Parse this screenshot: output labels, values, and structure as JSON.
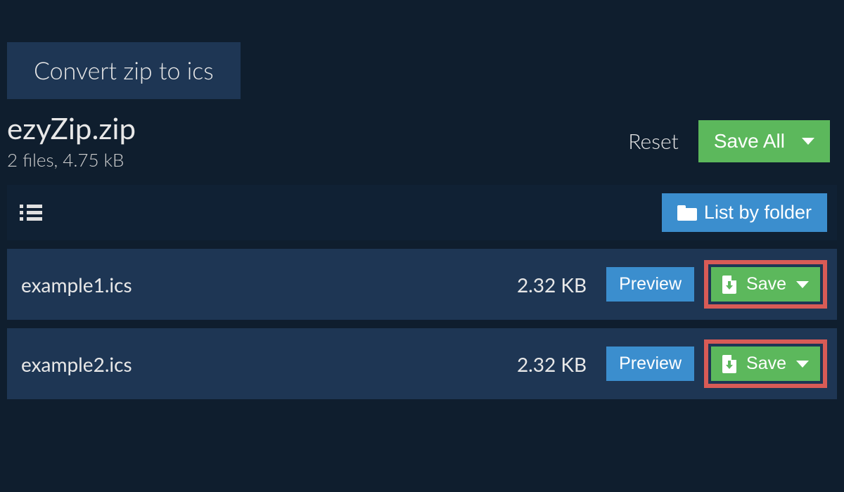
{
  "tab": {
    "label": "Convert zip to ics"
  },
  "header": {
    "archive_name": "ezyZip.zip",
    "meta": "2 files, 4.75 kB",
    "reset_label": "Reset",
    "save_all_label": "Save All"
  },
  "toolbar": {
    "list_by_folder_label": "List by folder"
  },
  "files": [
    {
      "name": "example1.ics",
      "size": "2.32 KB",
      "preview_label": "Preview",
      "save_label": "Save"
    },
    {
      "name": "example2.ics",
      "size": "2.32 KB",
      "preview_label": "Preview",
      "save_label": "Save"
    }
  ],
  "colors": {
    "green": "#5cb85c",
    "blue": "#3b8ece",
    "highlight": "#d85b56",
    "background": "#0f1e2e",
    "panel": "#1e3654"
  }
}
